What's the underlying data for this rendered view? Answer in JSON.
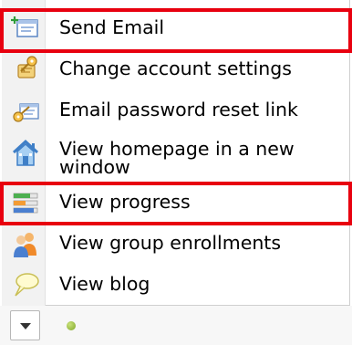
{
  "menu": {
    "items": [
      {
        "label": "Send Email",
        "icon": "send-email-icon"
      },
      {
        "label": "Change account settings",
        "icon": "key-settings-icon"
      },
      {
        "label": "Email password reset link",
        "icon": "key-email-icon"
      },
      {
        "label": "View homepage in a new window",
        "icon": "house-icon"
      },
      {
        "label": "View progress",
        "icon": "progress-bars-icon"
      },
      {
        "label": "View group enrollments",
        "icon": "group-users-icon"
      },
      {
        "label": "View blog",
        "icon": "speech-bubble-icon"
      }
    ]
  },
  "highlight_color": "#e8000f",
  "status_dot_color": "#8db33a"
}
